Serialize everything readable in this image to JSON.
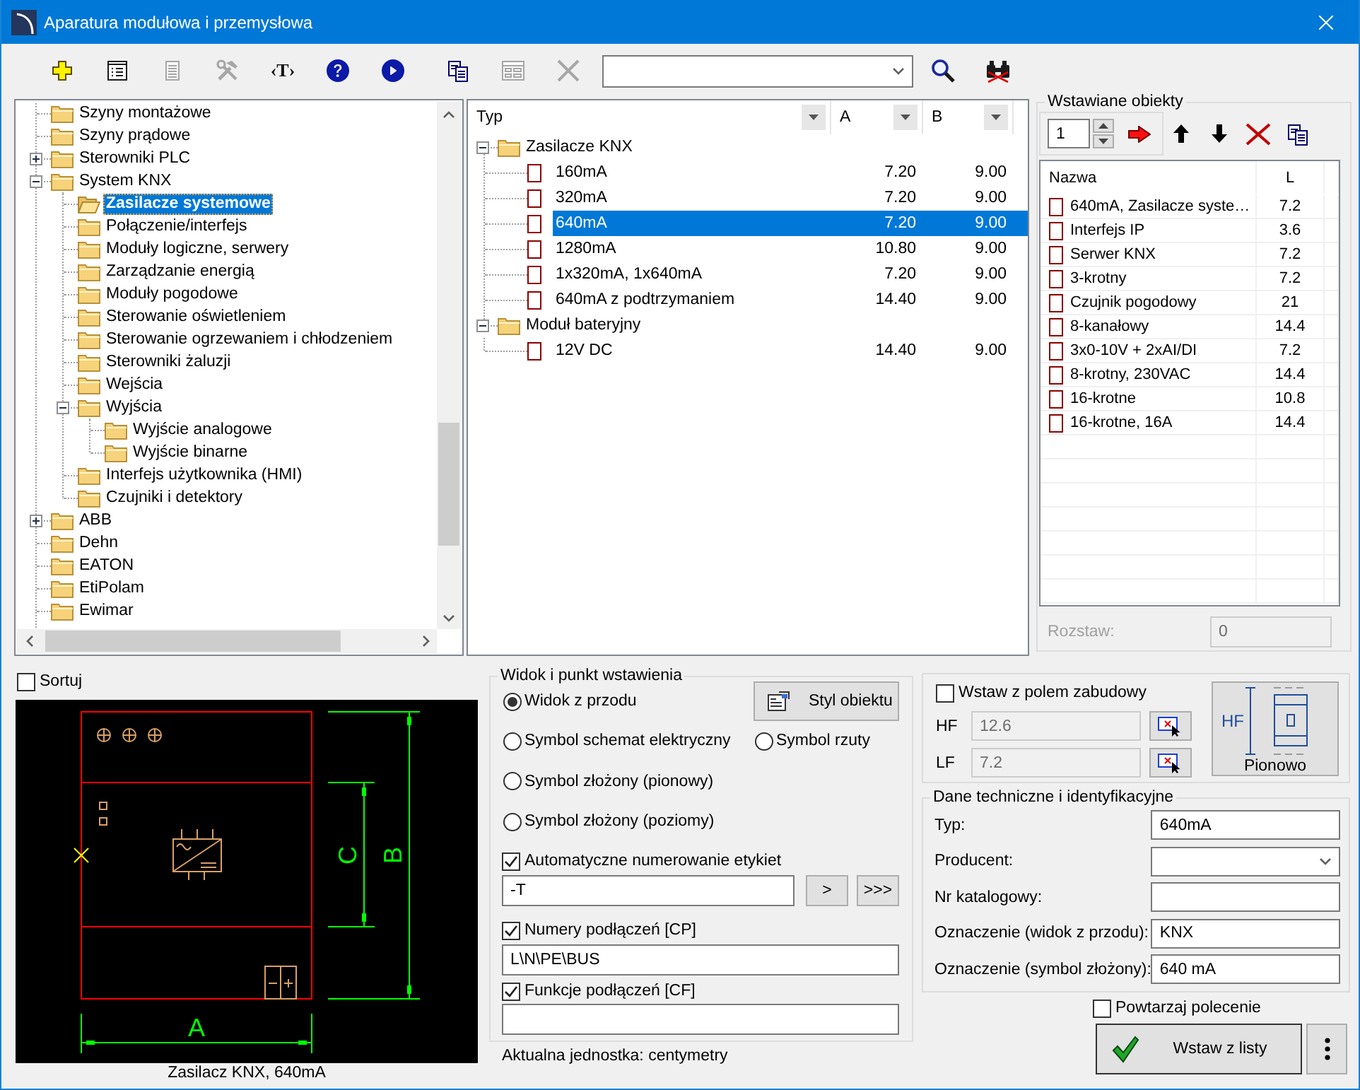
{
  "window": {
    "title": "Aparatura modułowa i przemysłowa"
  },
  "toolbar": {
    "tools": [
      {
        "kind": "add",
        "disabled": false
      },
      {
        "kind": "properties",
        "disabled": false
      },
      {
        "kind": "document",
        "disabled": true
      },
      {
        "kind": "tools",
        "disabled": true
      },
      {
        "kind": "text",
        "label": "‹T›",
        "disabled": false
      },
      {
        "kind": "help",
        "disabled": false
      },
      {
        "kind": "play",
        "disabled": false
      },
      {
        "kind": "copy",
        "disabled": false
      },
      {
        "kind": "form",
        "disabled": true
      },
      {
        "kind": "cut",
        "disabled": true
      }
    ],
    "search_tools": [
      {
        "kind": "search",
        "disabled": false
      },
      {
        "kind": "find",
        "disabled": false
      }
    ]
  },
  "tree": {
    "items": [
      {
        "label": "Szyny montażowe",
        "selected": false
      },
      {
        "label": "Szyny prądowe",
        "selected": false
      },
      {
        "label": "Sterowniki PLC",
        "expanded": false,
        "selected": false
      },
      {
        "label": "System KNX",
        "expanded": true,
        "selected": false,
        "children": [
          {
            "label": "Zasilacze systemowe",
            "selected": true
          },
          {
            "label": "Połączenie/interfejs",
            "selected": false
          },
          {
            "label": "Moduły logiczne, serwery",
            "selected": false
          },
          {
            "label": "Zarządzanie energią",
            "selected": false
          },
          {
            "label": "Moduły pogodowe",
            "selected": false
          },
          {
            "label": "Sterowanie oświetleniem",
            "selected": false
          },
          {
            "label": "Sterowanie ogrzewaniem i chłodzeniem",
            "selected": false
          },
          {
            "label": "Sterowniki żaluzji",
            "selected": false
          },
          {
            "label": "Wejścia",
            "selected": false
          },
          {
            "label": "Wyjścia",
            "expanded": true,
            "selected": false,
            "children": [
              {
                "label": "Wyjście analogowe",
                "selected": false
              },
              {
                "label": "Wyjście binarne",
                "selected": false
              }
            ]
          },
          {
            "label": "Interfejs użytkownika (HMI)",
            "selected": false
          },
          {
            "label": "Czujniki i detektory",
            "selected": false
          }
        ]
      },
      {
        "label": "ABB",
        "expanded": false,
        "selected": false
      },
      {
        "label": "Dehn",
        "selected": false
      },
      {
        "label": "EATON",
        "selected": false
      },
      {
        "label": "EtiPolam",
        "selected": false
      },
      {
        "label": "Ewimar",
        "selected": false
      }
    ]
  },
  "table": {
    "columns": [
      "Typ",
      "A",
      "B"
    ],
    "groups": [
      {
        "label": "Zasilacze KNX",
        "expanded": true,
        "rows": [
          {
            "type": "160mA",
            "a": "7.20",
            "b": "9.00",
            "selected": false
          },
          {
            "type": "320mA",
            "a": "7.20",
            "b": "9.00",
            "selected": false
          },
          {
            "type": "640mA",
            "a": "7.20",
            "b": "9.00",
            "selected": true
          },
          {
            "type": "1280mA",
            "a": "10.80",
            "b": "9.00",
            "selected": false
          },
          {
            "type": "1x320mA, 1x640mA",
            "a": "7.20",
            "b": "9.00",
            "selected": false
          },
          {
            "type": "640mA z podtrzymaniem",
            "a": "14.40",
            "b": "9.00",
            "selected": false
          }
        ]
      },
      {
        "label": "Moduł bateryjny",
        "expanded": true,
        "rows": [
          {
            "type": "12V DC",
            "a": "14.40",
            "b": "9.00",
            "selected": false
          }
        ]
      }
    ]
  },
  "inserted": {
    "title": "Wstawiane obiekty",
    "quantity": "1",
    "columns": [
      "Nazwa",
      "L"
    ],
    "rows": [
      {
        "name": "640mA, Zasilacze syste…",
        "l": "7.2",
        "selected": false
      },
      {
        "name": "Interfejs IP",
        "l": "3.6",
        "selected": false
      },
      {
        "name": "Serwer KNX",
        "l": "7.2",
        "selected": false
      },
      {
        "name": "3-krotny",
        "l": "7.2",
        "selected": false
      },
      {
        "name": "Czujnik pogodowy",
        "l": "21",
        "selected": false
      },
      {
        "name": "8-kanałowy",
        "l": "14.4",
        "selected": false
      },
      {
        "name": "3x0-10V + 2xAI/DI",
        "l": "7.2",
        "selected": false
      },
      {
        "name": "8-krotny, 230VAC",
        "l": "14.4",
        "selected": false
      },
      {
        "name": "16-krotne",
        "l": "10.8",
        "selected": false
      },
      {
        "name": "16-krotne, 16A",
        "l": "14.4",
        "selected": false
      }
    ],
    "spacing": {
      "label": "Rozstaw:",
      "value": "0",
      "disabled": true
    }
  },
  "sort": {
    "label": "Sortuj",
    "checked": false
  },
  "preview": {
    "dimension_labels": [
      "A",
      "C",
      "B"
    ],
    "caption": "Zasilacz KNX, 640mA"
  },
  "view": {
    "title": "Widok i punkt wstawienia",
    "options": [
      {
        "label": "Widok z przodu",
        "selected": true
      },
      {
        "label": "Symbol schemat elektryczny",
        "selected": false
      },
      {
        "label": "Symbol rzuty",
        "selected": false
      },
      {
        "label": "Symbol złożony (pionowy)",
        "selected": false
      },
      {
        "label": "Symbol złożony (poziomy)",
        "selected": false
      }
    ],
    "style_button": "Styl obiektu",
    "auto_numbering": {
      "label": "Automatyczne numerowanie etykiet",
      "checked": true,
      "value": "-T",
      "buttons": [
        ">",
        ">>>"
      ]
    },
    "connection_numbers": {
      "label": "Numery podłączeń [CP]",
      "checked": true,
      "value": "L\\N\\PE\\BUS"
    },
    "connection_functions": {
      "label": "Funkcje podłączeń [CF]",
      "checked": true
    }
  },
  "unit_note": "Aktualna jednostka: centymetry",
  "mounting": {
    "checkbox": {
      "label": "Wstaw z polem zabudowy",
      "checked": false
    },
    "fields": [
      {
        "label": "HF",
        "value": "12.6",
        "disabled": true
      },
      {
        "label": "LF",
        "value": "7.2",
        "disabled": true
      }
    ],
    "orientation": {
      "axis_label": "HF",
      "label": "Pionowo"
    }
  },
  "tech": {
    "title": "Dane techniczne i identyfikacyjne",
    "fields": [
      {
        "label": "Typ:",
        "value": "640mA",
        "kind": "text"
      },
      {
        "label": "Producent:",
        "kind": "dropdown"
      },
      {
        "label": "Nr katalogowy:",
        "kind": "text"
      },
      {
        "label": "Oznaczenie (widok z przodu):",
        "value": "KNX",
        "kind": "text"
      },
      {
        "label": "Oznaczenie (symbol złożony):",
        "value": "640 mA",
        "kind": "text"
      }
    ]
  },
  "repeat": {
    "label": "Powtarzaj polecenie",
    "checked": false
  },
  "insert_button": {
    "label": "Wstaw z listy"
  }
}
